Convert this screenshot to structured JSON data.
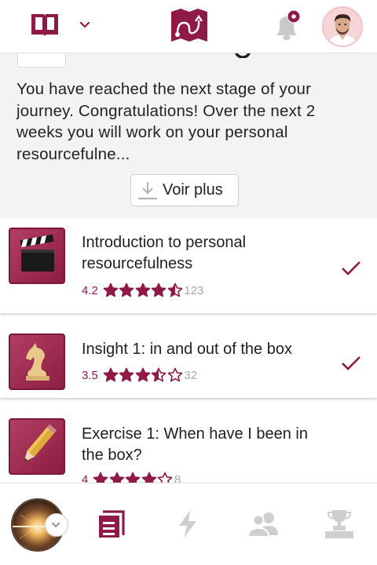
{
  "header": {
    "icons": [
      "book-icon",
      "chevron-down-icon",
      "journey-map-logo",
      "bell-icon",
      "avatar"
    ],
    "notification_dot": true
  },
  "intro": {
    "description": "You have reached the next stage of your journey. Congratulations! Over the next 2 weeks you will work on your personal resourcefulne...",
    "more_button_label": "Voir plus"
  },
  "lessons": [
    {
      "title": "Introduction to personal resourcefulness",
      "rating": "4.2",
      "stars": 4.5,
      "count": "123",
      "icon": "clapperboard-icon",
      "completed": true
    },
    {
      "title": "Insight 1: in and out of the box",
      "rating": "3.5",
      "stars": 3.5,
      "count": "32",
      "icon": "chess-knight-icon",
      "completed": true
    },
    {
      "title": "Exercise 1: When have I been in the box?",
      "rating": "4",
      "stars": 4,
      "count": "8",
      "icon": "pencil-icon",
      "completed": false
    }
  ],
  "bottom_nav": {
    "items": [
      "content-icon",
      "lightning-icon",
      "people-icon",
      "trophy-icon"
    ],
    "active": "content-icon"
  },
  "colors": {
    "brand": "#8e1a45",
    "inactive_icon": "#cfcfcf",
    "background": "#f3f3f3"
  }
}
